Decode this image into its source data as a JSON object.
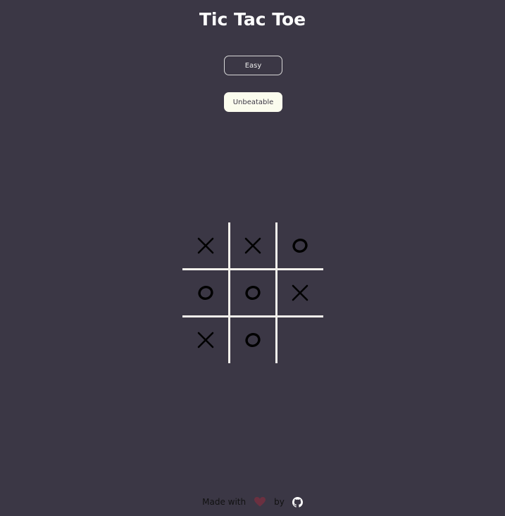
{
  "title": "Tic Tac Toe",
  "buttons": {
    "easy_label": "Easy",
    "unbeatable_label": "Unbeatable"
  },
  "board": {
    "cells": [
      "X",
      "X",
      "O",
      "O",
      "O",
      "X",
      "X",
      "O",
      ""
    ],
    "grid_color": "#f4f1ec",
    "mark_color": "#000000"
  },
  "footer": {
    "made_with": "Made with",
    "by": "by",
    "heart_icon": "heart-icon",
    "github_icon": "github-icon",
    "heart_color": "#6b3040"
  },
  "colors": {
    "background": "#3b3745",
    "title": "#ffffff",
    "unbeatable_bg": "#fbfcee"
  }
}
